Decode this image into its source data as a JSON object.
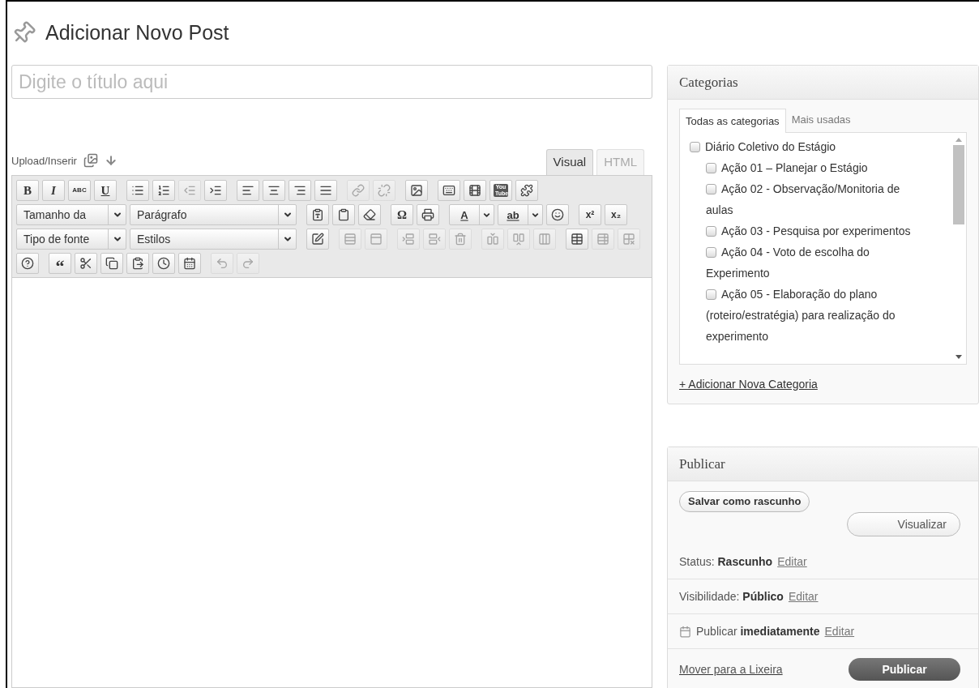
{
  "page_title": "Adicionar Novo Post",
  "title_field": {
    "placeholder": "Digite o título aqui"
  },
  "media": {
    "label": "Upload/Inserir"
  },
  "editor_tabs": [
    {
      "label": "Visual",
      "selected": true
    },
    {
      "label": "HTML",
      "selected": false
    }
  ],
  "toolbar_rows": [
    [
      [
        {
          "kind": "bold",
          "label": "B",
          "disabled": false
        },
        {
          "kind": "italic",
          "label": "I",
          "disabled": false
        },
        {
          "kind": "strike",
          "label": "ABC",
          "disabled": false
        },
        {
          "kind": "underline",
          "label": "U",
          "disabled": false
        }
      ],
      [
        {
          "kind": "bullets",
          "disabled": false
        },
        {
          "kind": "numbers",
          "disabled": false
        },
        {
          "kind": "outdent",
          "disabled": true
        },
        {
          "kind": "indent",
          "disabled": false
        }
      ],
      [
        {
          "kind": "align-left",
          "disabled": false
        },
        {
          "kind": "align-center",
          "disabled": false
        },
        {
          "kind": "align-right",
          "disabled": false
        },
        {
          "kind": "align-justify",
          "disabled": false
        }
      ],
      [
        {
          "kind": "link",
          "disabled": true
        },
        {
          "kind": "unlink",
          "disabled": true
        }
      ],
      [
        {
          "kind": "image",
          "disabled": false
        }
      ],
      [
        {
          "kind": "kitchen",
          "disabled": false
        },
        {
          "kind": "film",
          "disabled": false
        },
        {
          "kind": "youtube",
          "label": "You Tube",
          "disabled": false
        },
        {
          "kind": "puzzle",
          "disabled": false
        }
      ]
    ],
    [
      [
        {
          "kind": "select",
          "label": "Tamanho da",
          "disabled": false
        },
        {
          "kind": "select-wide",
          "label": "Parágrafo",
          "disabled": false
        }
      ],
      [
        {
          "kind": "paste-text",
          "disabled": false
        },
        {
          "kind": "paste-word",
          "disabled": false
        },
        {
          "kind": "eraser",
          "disabled": false
        }
      ],
      [
        {
          "kind": "charmap",
          "label": "Ω",
          "disabled": false
        },
        {
          "kind": "print",
          "disabled": false
        }
      ],
      [
        {
          "kind": "color",
          "label": "A",
          "disabled": false
        },
        {
          "kind": "color",
          "label": "ab",
          "disabled": false
        },
        {
          "kind": "smile",
          "disabled": false
        }
      ],
      [
        {
          "kind": "script",
          "label": "x²",
          "disabled": false
        },
        {
          "kind": "script",
          "label": "x₂",
          "disabled": false
        }
      ]
    ],
    [
      [
        {
          "kind": "select",
          "label": "Tipo de fonte",
          "disabled": false
        },
        {
          "kind": "select-wide",
          "label": "Estilos",
          "disabled": false
        }
      ],
      [
        {
          "kind": "edit-style",
          "disabled": false
        }
      ],
      [
        {
          "kind": "row-props",
          "disabled": true
        },
        {
          "kind": "cell-props",
          "disabled": true
        }
      ],
      [
        {
          "kind": "row-before",
          "disabled": true
        },
        {
          "kind": "row-after",
          "disabled": true
        },
        {
          "kind": "row-delete",
          "disabled": true
        }
      ],
      [
        {
          "kind": "col-before",
          "disabled": true
        },
        {
          "kind": "col-after",
          "disabled": true
        },
        {
          "kind": "col-delete",
          "disabled": true
        }
      ],
      [
        {
          "kind": "table",
          "disabled": false
        },
        {
          "kind": "table-split",
          "disabled": true
        },
        {
          "kind": "table-delete",
          "disabled": true
        }
      ]
    ],
    [
      [
        {
          "kind": "help",
          "disabled": false
        }
      ],
      [
        {
          "kind": "quote",
          "label": "“",
          "disabled": false
        },
        {
          "kind": "cut",
          "disabled": false
        },
        {
          "kind": "copy",
          "disabled": false
        },
        {
          "kind": "paste",
          "disabled": false
        },
        {
          "kind": "clock",
          "disabled": false
        },
        {
          "kind": "calendar",
          "disabled": false
        }
      ],
      [
        {
          "kind": "undo",
          "disabled": true
        },
        {
          "kind": "redo",
          "disabled": true
        }
      ]
    ]
  ],
  "categories": {
    "title": "Categorias",
    "tabs": [
      {
        "label": "Todas as categorias",
        "selected": true
      },
      {
        "label": "Mais usadas",
        "selected": false
      }
    ],
    "items": [
      {
        "label": "Diário Coletivo do Estágio",
        "checked": false,
        "children": [
          {
            "label": "Ação 01 – Planejar o Estágio",
            "checked": false
          },
          {
            "label": "Ação 02 - Observação/Monitoria de aulas",
            "checked": false
          },
          {
            "label": "Ação 03 - Pesquisa por experimentos",
            "checked": false
          },
          {
            "label": "Ação 04 - Voto de escolha do Experimento",
            "checked": false
          },
          {
            "label": "Ação 05 - Elaboração do plano (roteiro/estratégia) para realização do experimento",
            "checked": false
          }
        ]
      }
    ],
    "add_link": "+ Adicionar Nova Categoria"
  },
  "publish": {
    "title": "Publicar",
    "save_button": "Salvar como rascunho",
    "preview_button": "Visualizar",
    "rows": [
      {
        "kind": "text",
        "label": "Status:",
        "value": "Rascunho",
        "link": "Editar"
      },
      {
        "kind": "text",
        "label": "Visibilidade:",
        "value": "Público",
        "link": "Editar"
      },
      {
        "kind": "date",
        "label": "Publicar",
        "value": "imediatamente",
        "link": "Editar"
      }
    ],
    "trash_link": "Mover para a Lixeira",
    "publish_button": "Publicar"
  }
}
